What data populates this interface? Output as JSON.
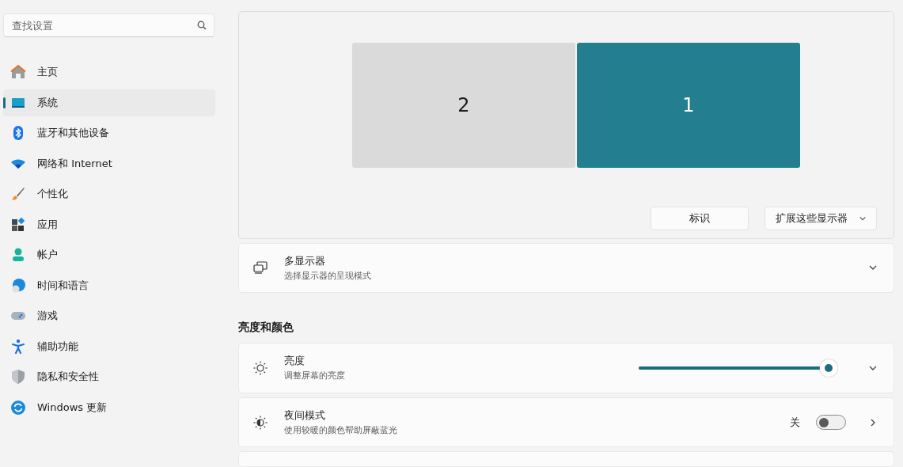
{
  "search": {
    "placeholder": "查找设置"
  },
  "sidebar": {
    "items": [
      {
        "label": "主页",
        "selected": false
      },
      {
        "label": "系统",
        "selected": true
      },
      {
        "label": "蓝牙和其他设备",
        "selected": false
      },
      {
        "label": "网络和 Internet",
        "selected": false
      },
      {
        "label": "个性化",
        "selected": false
      },
      {
        "label": "应用",
        "selected": false
      },
      {
        "label": "帐户",
        "selected": false
      },
      {
        "label": "时间和语言",
        "selected": false
      },
      {
        "label": "游戏",
        "selected": false
      },
      {
        "label": "辅助功能",
        "selected": false
      },
      {
        "label": "隐私和安全性",
        "selected": false
      },
      {
        "label": "Windows 更新",
        "selected": false
      }
    ]
  },
  "displays": [
    {
      "label": "2",
      "selected": false
    },
    {
      "label": "1",
      "selected": true
    }
  ],
  "display_buttons": {
    "identify": "标识",
    "mode": "扩展这些显示器"
  },
  "multi_display": {
    "title": "多显示器",
    "subtitle": "选择显示器的呈现模式"
  },
  "section_heading": "亮度和颜色",
  "settings": [
    {
      "kind": "slider",
      "title": "亮度",
      "subtitle": "调整屏幕的亮度",
      "level": 0.98
    },
    {
      "kind": "toggle",
      "title": "夜间模式",
      "subtitle": "使用较暖的颜色帮助屏蔽蓝光",
      "state_label": "关",
      "on": false
    }
  ]
}
